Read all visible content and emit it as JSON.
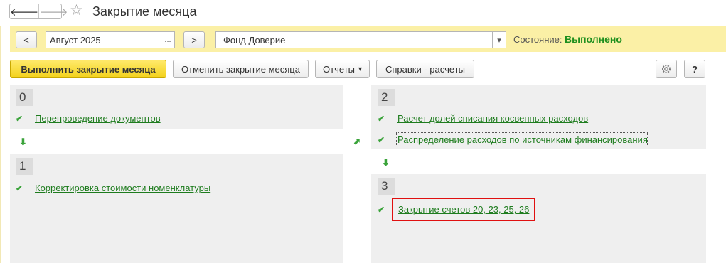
{
  "title": "Закрытие месяца",
  "nav": {
    "back": "🡐",
    "forward": "🡒"
  },
  "filter": {
    "prev": "<",
    "period": "Август 2025",
    "period_choose": "...",
    "next": ">",
    "organization": "Фонд Доверие",
    "org_dropdown": "▾",
    "state_label": "Состояние:",
    "state_value": "Выполнено"
  },
  "toolbar": {
    "run": "Выполнить закрытие месяца",
    "cancel": "Отменить закрытие месяца",
    "reports": "Отчеты",
    "reports_arrow": "▾",
    "help_calc": "Справки - расчеты",
    "settings_icon": "gear-icon",
    "help": "?"
  },
  "stages": [
    {
      "number": "0",
      "items": [
        "Перепроведение документов"
      ]
    },
    {
      "number": "1",
      "items": [
        "Корректировка стоимости номенклатуры"
      ]
    },
    {
      "number": "2",
      "items": [
        "Расчет долей списания косвенных расходов",
        "Распределение расходов по источникам финансирования"
      ]
    },
    {
      "number": "3",
      "items": [
        "Закрытие счетов 20, 23, 25, 26"
      ]
    }
  ],
  "colors": {
    "accent_green": "#1e7c1e",
    "yellow_bar": "#fbf0a6",
    "highlight": "#e01010"
  }
}
